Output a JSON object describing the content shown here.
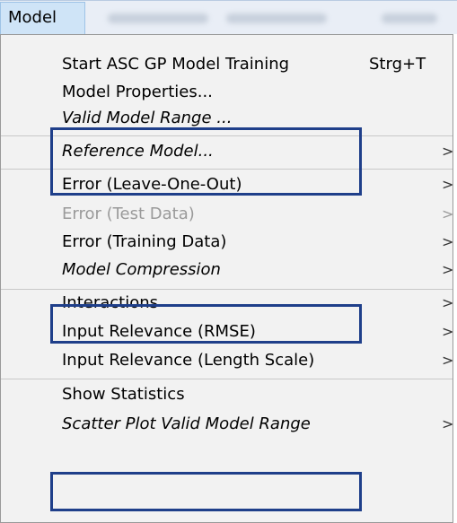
{
  "menubar": {
    "active_menu": "Model"
  },
  "menu": {
    "items": [
      {
        "label": "Start ASC GP Model Training",
        "shortcut": "Strg+T"
      },
      {
        "label": "Model Properties..."
      },
      {
        "label": "Valid Model Range ..."
      },
      {
        "label": "Reference Model...",
        "submenu": ">"
      },
      {
        "label": "Error (Leave-One-Out)",
        "submenu": ">"
      },
      {
        "label": "Error (Test Data)",
        "submenu": ">",
        "disabled": true
      },
      {
        "label": "Error (Training Data)",
        "submenu": ">"
      },
      {
        "label": "Model Compression",
        "submenu": ">"
      },
      {
        "label": "Interactions",
        "submenu": ">"
      },
      {
        "label": "Input Relevance (RMSE)",
        "submenu": ">"
      },
      {
        "label": "Input Relevance (Length Scale)",
        "submenu": ">"
      },
      {
        "label": "Show Statistics"
      },
      {
        "label": "Scatter Plot Valid Model Range",
        "submenu": ">"
      }
    ]
  },
  "colors": {
    "highlight_box": "#1f3f8a",
    "menu_background": "#f2f2f2",
    "menubar_active": "#cfe4f7"
  }
}
